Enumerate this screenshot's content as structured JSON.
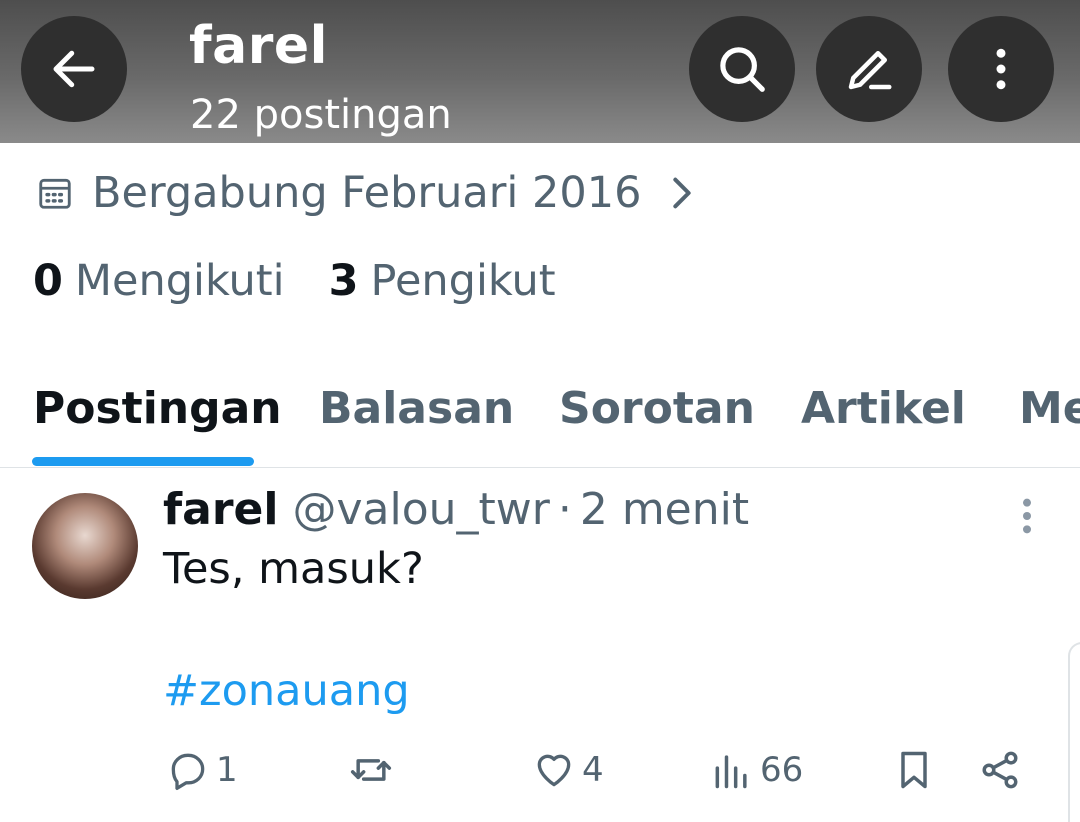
{
  "header": {
    "title": "farel",
    "subtitle": "22 postingan",
    "icons": [
      "back-arrow-icon",
      "search-icon",
      "edit-icon",
      "more-vertical-icon"
    ]
  },
  "profile": {
    "joined": "Bergabung Februari 2016",
    "following_count": "0",
    "following_label": "Mengikuti",
    "followers_count": "3",
    "followers_label": "Pengikut"
  },
  "tabs": [
    {
      "label": "Postingan",
      "active": true
    },
    {
      "label": "Balasan",
      "active": false
    },
    {
      "label": "Sorotan",
      "active": false
    },
    {
      "label": "Artikel",
      "active": false
    },
    {
      "label": "Me",
      "active": false
    }
  ],
  "post": {
    "name": "farel",
    "handle": "@valou_twr",
    "separator": "·",
    "time": "2 menit",
    "text": "Tes, masuk?",
    "hashtag": "#zonauang",
    "actions": {
      "replies": "1",
      "reposts": "",
      "likes": "4",
      "views": "66"
    }
  },
  "colors": {
    "accent": "#1d9bf0",
    "secondary_text": "#536471",
    "primary_text": "#0f1419"
  }
}
